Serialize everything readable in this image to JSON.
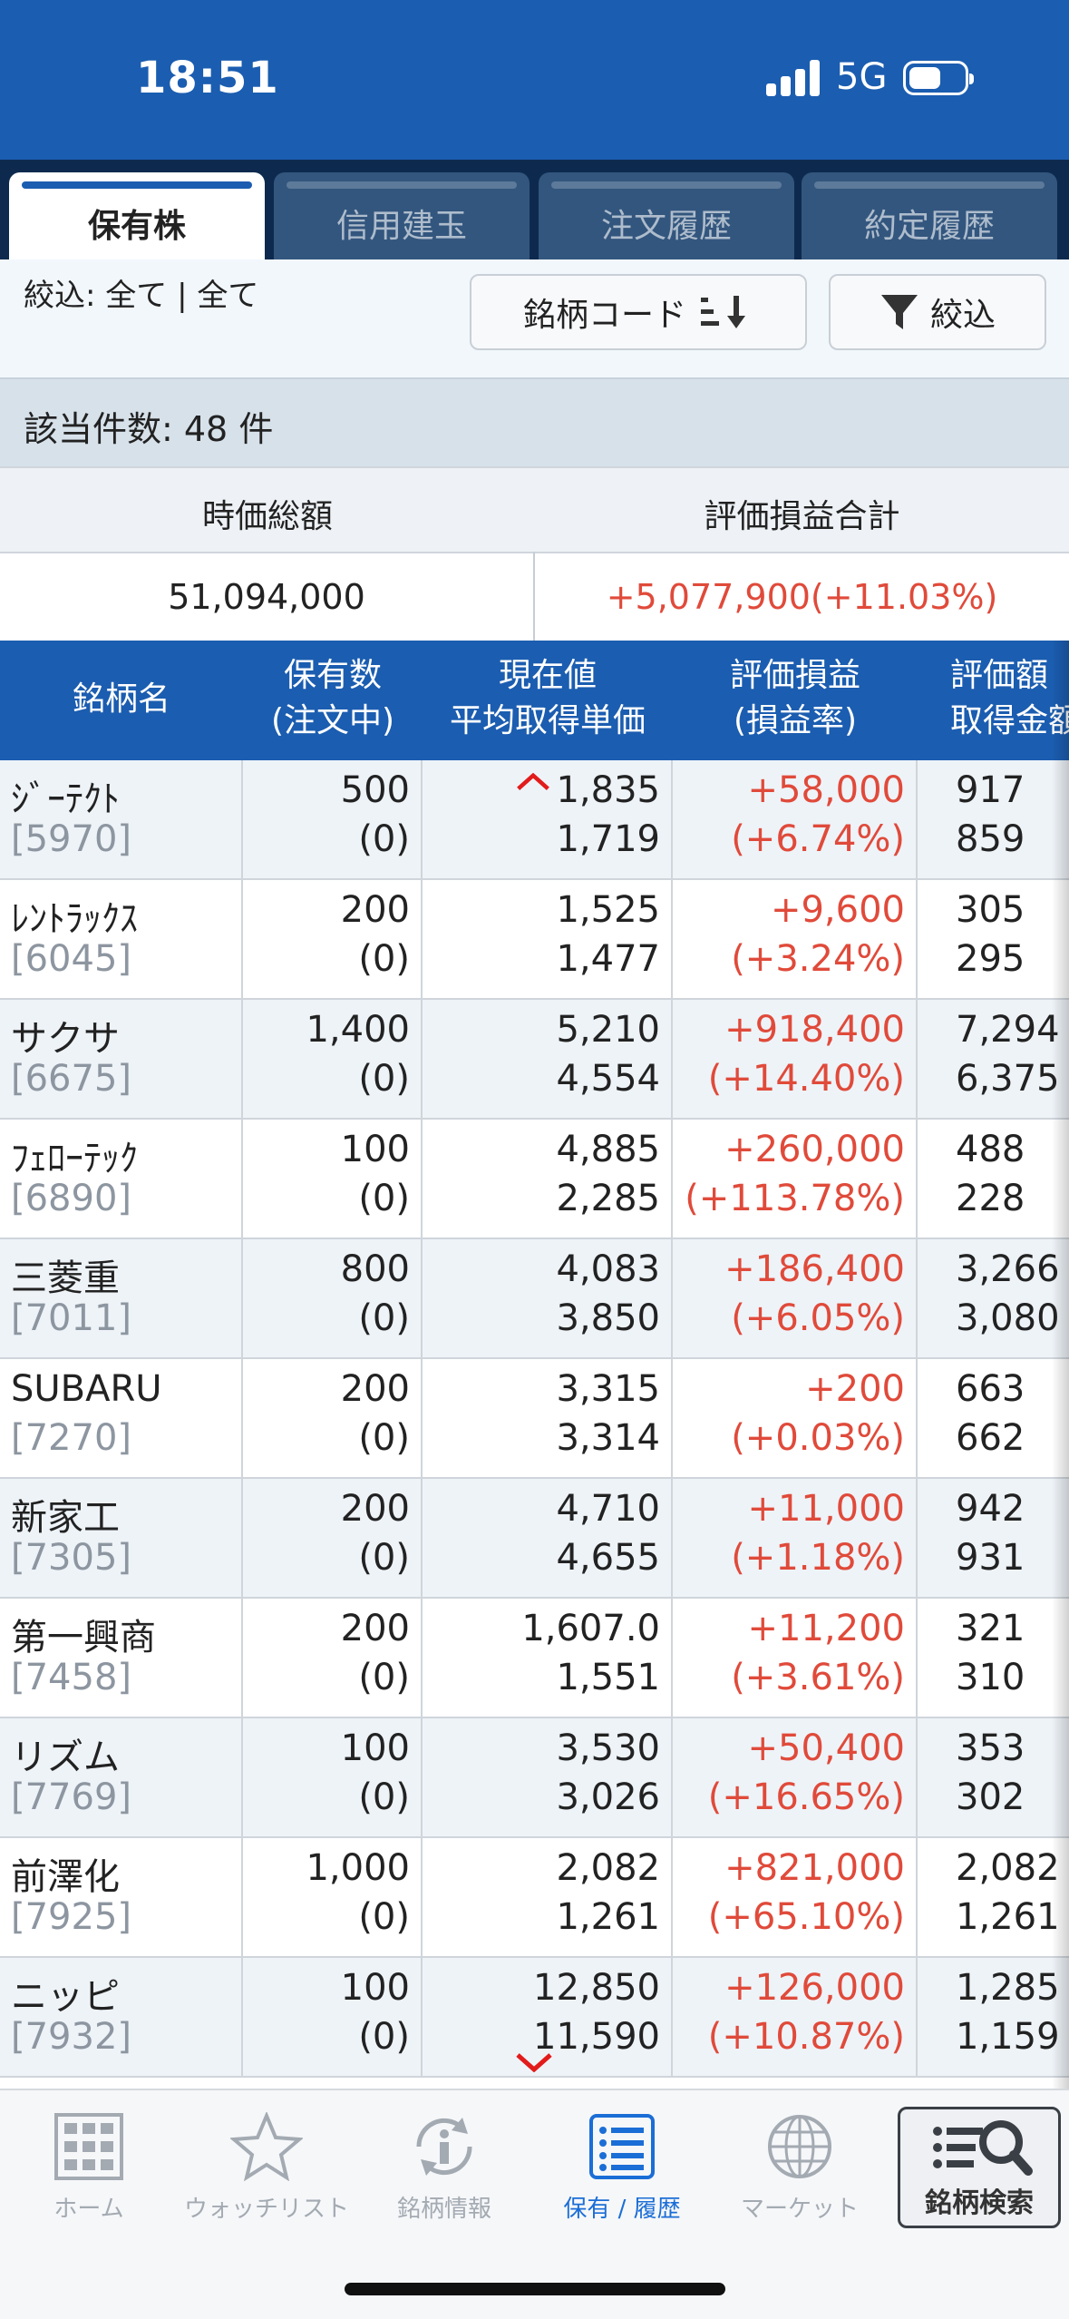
{
  "status_bar": {
    "time": "18:51",
    "network": "5G"
  },
  "tabs": [
    {
      "label": "保有株",
      "active": true
    },
    {
      "label": "信用建玉",
      "active": false
    },
    {
      "label": "注文履歴",
      "active": false
    },
    {
      "label": "約定履歴",
      "active": false
    }
  ],
  "filter": {
    "text": "絞込:  全て | 全て",
    "sort_label": "銘柄コード",
    "filter_label": "絞込"
  },
  "count": {
    "text": "該当件数: 48 件"
  },
  "summary": {
    "market_value_label": "時価総額",
    "pl_total_label": "評価損益合計",
    "market_value": "51,094,000",
    "pl_total": "+5,077,900(+11.03%)"
  },
  "table_header": {
    "name": "銘柄名",
    "qty_1": "保有数",
    "qty_2": "(注文中)",
    "price_1": "現在値",
    "price_2": "平均取得単価",
    "pl_1": "評価損益",
    "pl_2": "(損益率)",
    "val_1": "評価額",
    "val_2": "取得金額"
  },
  "rows": [
    {
      "name": "ｼﾞｰﾃｸﾄ",
      "code": "[5970]",
      "qty": "500",
      "ordering": "(0)",
      "price": "1,835",
      "avg": "1,719",
      "pl": "+58,000",
      "rate": "(+6.74%)",
      "val": "917",
      "cost": "859"
    },
    {
      "name": "ﾚﾝﾄﾗｯｸｽ",
      "code": "[6045]",
      "qty": "200",
      "ordering": "(0)",
      "price": "1,525",
      "avg": "1,477",
      "pl": "+9,600",
      "rate": "(+3.24%)",
      "val": "305",
      "cost": "295"
    },
    {
      "name": "サクサ",
      "code": "[6675]",
      "qty": "1,400",
      "ordering": "(0)",
      "price": "5,210",
      "avg": "4,554",
      "pl": "+918,400",
      "rate": "(+14.40%)",
      "val": "7,294",
      "cost": "6,375"
    },
    {
      "name": "ﾌｪﾛｰﾃｯｸ",
      "code": "[6890]",
      "qty": "100",
      "ordering": "(0)",
      "price": "4,885",
      "avg": "2,285",
      "pl": "+260,000",
      "rate": "(+113.78%)",
      "val": "488",
      "cost": "228"
    },
    {
      "name": "三菱重",
      "code": "[7011]",
      "qty": "800",
      "ordering": "(0)",
      "price": "4,083",
      "avg": "3,850",
      "pl": "+186,400",
      "rate": "(+6.05%)",
      "val": "3,266",
      "cost": "3,080"
    },
    {
      "name": "SUBARU",
      "code": "[7270]",
      "qty": "200",
      "ordering": "(0)",
      "price": "3,315",
      "avg": "3,314",
      "pl": "+200",
      "rate": "(+0.03%)",
      "val": "663",
      "cost": "662"
    },
    {
      "name": "新家工",
      "code": "[7305]",
      "qty": "200",
      "ordering": "(0)",
      "price": "4,710",
      "avg": "4,655",
      "pl": "+11,000",
      "rate": "(+1.18%)",
      "val": "942",
      "cost": "931"
    },
    {
      "name": "第一興商",
      "code": "[7458]",
      "qty": "200",
      "ordering": "(0)",
      "price": "1,607.0",
      "avg": "1,551",
      "pl": "+11,200",
      "rate": "(+3.61%)",
      "val": "321",
      "cost": "310"
    },
    {
      "name": "リズム",
      "code": "[7769]",
      "qty": "100",
      "ordering": "(0)",
      "price": "3,530",
      "avg": "3,026",
      "pl": "+50,400",
      "rate": "(+16.65%)",
      "val": "353",
      "cost": "302"
    },
    {
      "name": "前澤化",
      "code": "[7925]",
      "qty": "1,000",
      "ordering": "(0)",
      "price": "2,082",
      "avg": "1,261",
      "pl": "+821,000",
      "rate": "(+65.10%)",
      "val": "2,082",
      "cost": "1,261"
    },
    {
      "name": "ニッピ",
      "code": "[7932]",
      "qty": "100",
      "ordering": "(0)",
      "price": "12,850",
      "avg": "11,590",
      "pl": "+126,000",
      "rate": "(+10.87%)",
      "val": "1,285",
      "cost": "1,159"
    }
  ],
  "bottom_nav": [
    {
      "label": "ホーム",
      "icon": "grid-icon",
      "active": false
    },
    {
      "label": "ウォッチリスト",
      "icon": "star-icon",
      "active": false
    },
    {
      "label": "銘柄情報",
      "icon": "info-refresh-icon",
      "active": false
    },
    {
      "label": "保有 / 履歴",
      "icon": "list-icon",
      "active": true
    },
    {
      "label": "マーケット",
      "icon": "globe-icon",
      "active": false
    }
  ],
  "search_button": {
    "label": "銘柄検索",
    "icon": "search-list-icon"
  },
  "colors": {
    "header_blue": "#1b5db0",
    "tab_dark": "#0d2a4e",
    "profit_red": "#e04a3a",
    "nav_active": "#1b6ed6"
  }
}
